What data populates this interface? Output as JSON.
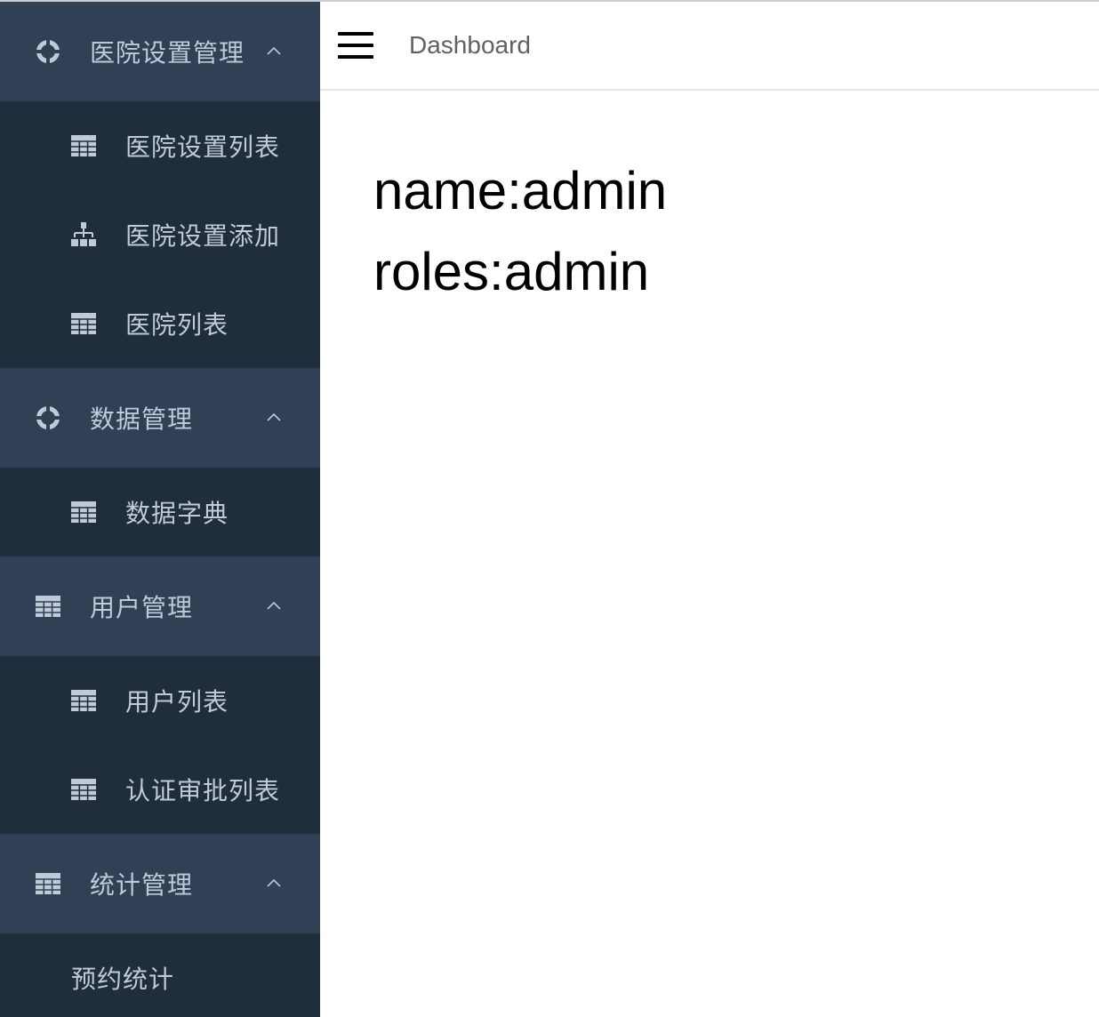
{
  "sidebar": {
    "groups": [
      {
        "label": "医院设置管理",
        "icon": "help-icon",
        "expanded": true,
        "items": [
          {
            "label": "医院设置列表",
            "icon": "table-icon"
          },
          {
            "label": "医院设置添加",
            "icon": "tree-icon"
          },
          {
            "label": "医院列表",
            "icon": "table-icon"
          }
        ]
      },
      {
        "label": "数据管理",
        "icon": "help-icon",
        "expanded": true,
        "items": [
          {
            "label": "数据字典",
            "icon": "table-icon"
          }
        ]
      },
      {
        "label": "用户管理",
        "icon": "table-icon",
        "expanded": true,
        "items": [
          {
            "label": "用户列表",
            "icon": "table-icon"
          },
          {
            "label": "认证审批列表",
            "icon": "table-icon"
          }
        ]
      },
      {
        "label": "统计管理",
        "icon": "table-icon",
        "expanded": true,
        "items": [
          {
            "label": "预约统计",
            "icon": ""
          }
        ]
      }
    ]
  },
  "navbar": {
    "menu_icon": "hamburger-icon",
    "breadcrumb": "Dashboard"
  },
  "dashboard": {
    "name_line": "name:admin",
    "roles_line": "roles:admin"
  },
  "colors": {
    "sidebar_bg": "#1f2d3d",
    "sidebar_group_bg": "#304156",
    "sidebar_text": "#bfcbd9",
    "breadcrumb_text": "#606266"
  }
}
